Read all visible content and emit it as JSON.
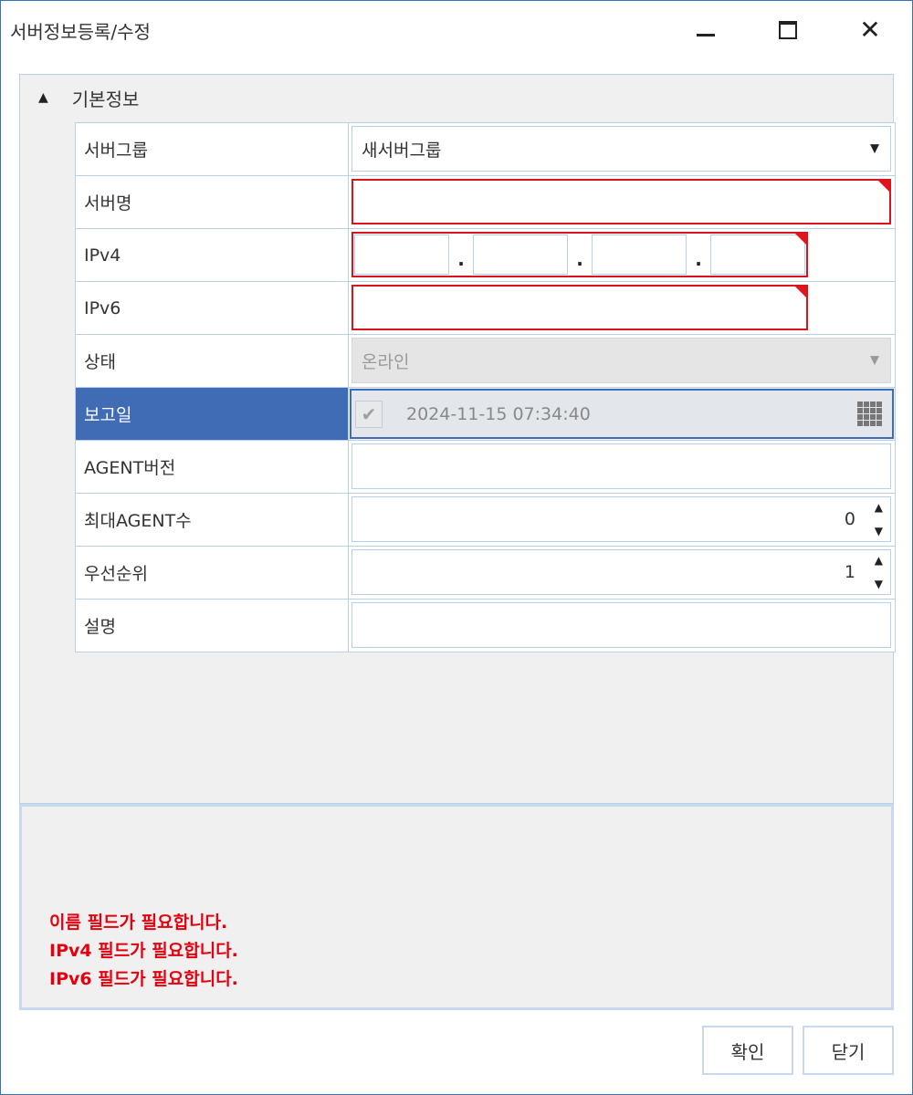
{
  "window": {
    "title": "서버정보등록/수정",
    "controls": [
      "minimize-icon",
      "maximize-icon",
      "close-icon"
    ]
  },
  "group": {
    "header": "기본정보",
    "collapse_icon": "triangle-up-icon"
  },
  "form": {
    "server_group": {
      "label": "서버그룹",
      "value": "새서버그룹"
    },
    "server_name": {
      "label": "서버명",
      "value": ""
    },
    "ipv4": {
      "label": "IPv4",
      "octets": [
        "",
        "",
        "",
        ""
      ],
      "separator": "."
    },
    "ipv6": {
      "label": "IPv6",
      "value": ""
    },
    "status": {
      "label": "상태",
      "value": "온라인"
    },
    "report_date": {
      "label": "보고일",
      "value": "2024-11-15 07:34:40",
      "checked": true
    },
    "agent_version": {
      "label": "AGENT버전",
      "value": ""
    },
    "max_agents": {
      "label": "최대AGENT수",
      "value": "0"
    },
    "priority": {
      "label": "우선순위",
      "value": "1"
    },
    "description": {
      "label": "설명",
      "value": ""
    }
  },
  "messages": [
    "이름 필드가 필요합니다.",
    "IPv4 필드가 필요합니다.",
    "IPv6 필드가 필요합니다."
  ],
  "buttons": {
    "ok": "확인",
    "close": "닫기"
  },
  "colors": {
    "accent": "#3f6cb5",
    "error": "#e3000f",
    "border": "#b9d0ea",
    "panel": "#f0f0f0"
  }
}
